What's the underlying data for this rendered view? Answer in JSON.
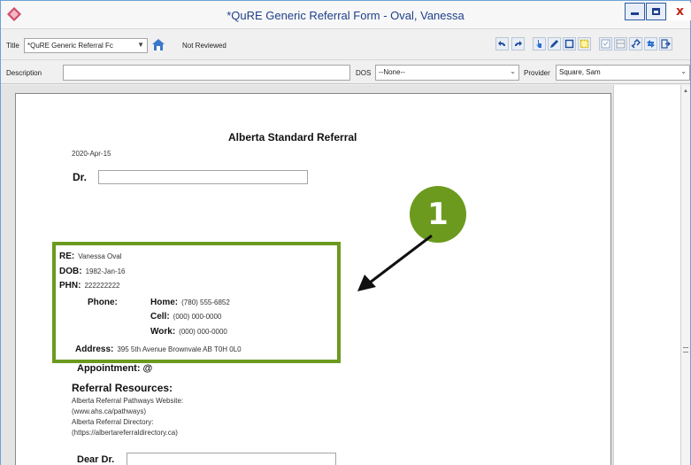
{
  "window": {
    "title": "*QuRE Generic Referral Form - Oval, Vanessa",
    "close_glyph": "x",
    "app_icon": "app-diamond-icon"
  },
  "toolbar": {
    "title_label": "Title",
    "title_value": "*QuRE Generic Referral Fc",
    "review_status": "Not Reviewed",
    "icons": [
      "home-icon",
      "undo-icon",
      "redo-icon",
      "pointer-icon",
      "pen-icon",
      "rectangle-icon",
      "highlight-icon",
      "checkbox-icon",
      "table-icon",
      "link-icon",
      "share-icon",
      "exit-icon"
    ]
  },
  "fields": {
    "description_label": "Description",
    "description_value": "",
    "dos_label": "DOS",
    "dos_value": "--None--",
    "provider_label": "Provider",
    "provider_value": "Square, Sam"
  },
  "document": {
    "heading": "Alberta Standard Referral",
    "date": "2020-Apr-15",
    "dr_label": "Dr.",
    "re_label": "RE:",
    "re_value": "Vanessa Oval",
    "dob_label": "DOB:",
    "dob_value": "1982-Jan-16",
    "phn_label": "PHN:",
    "phn_value": "222222222",
    "phone_label": "Phone:",
    "home_label": "Home:",
    "home_value": "(780) 555-6852",
    "cell_label": "Cell:",
    "cell_value": "(000) 000-0000",
    "work_label": "Work:",
    "work_value": "(000) 000-0000",
    "address_label": "Address:",
    "address_value": "395 5th Avenue Brownvale AB T0H 0L0",
    "appointment_label": "Appointment:",
    "appointment_value": "@",
    "resources_heading": "Referral Resources:",
    "resources": [
      "Alberta Referral Pathways Website:",
      "(www.ahs.ca/pathways)",
      "Alberta Referral Directory:",
      "(https://albertareferraldirectory.ca)"
    ],
    "dear_label": "Dear Dr."
  },
  "annotation": {
    "callout_number": "1",
    "color": "#6b9a1e"
  }
}
